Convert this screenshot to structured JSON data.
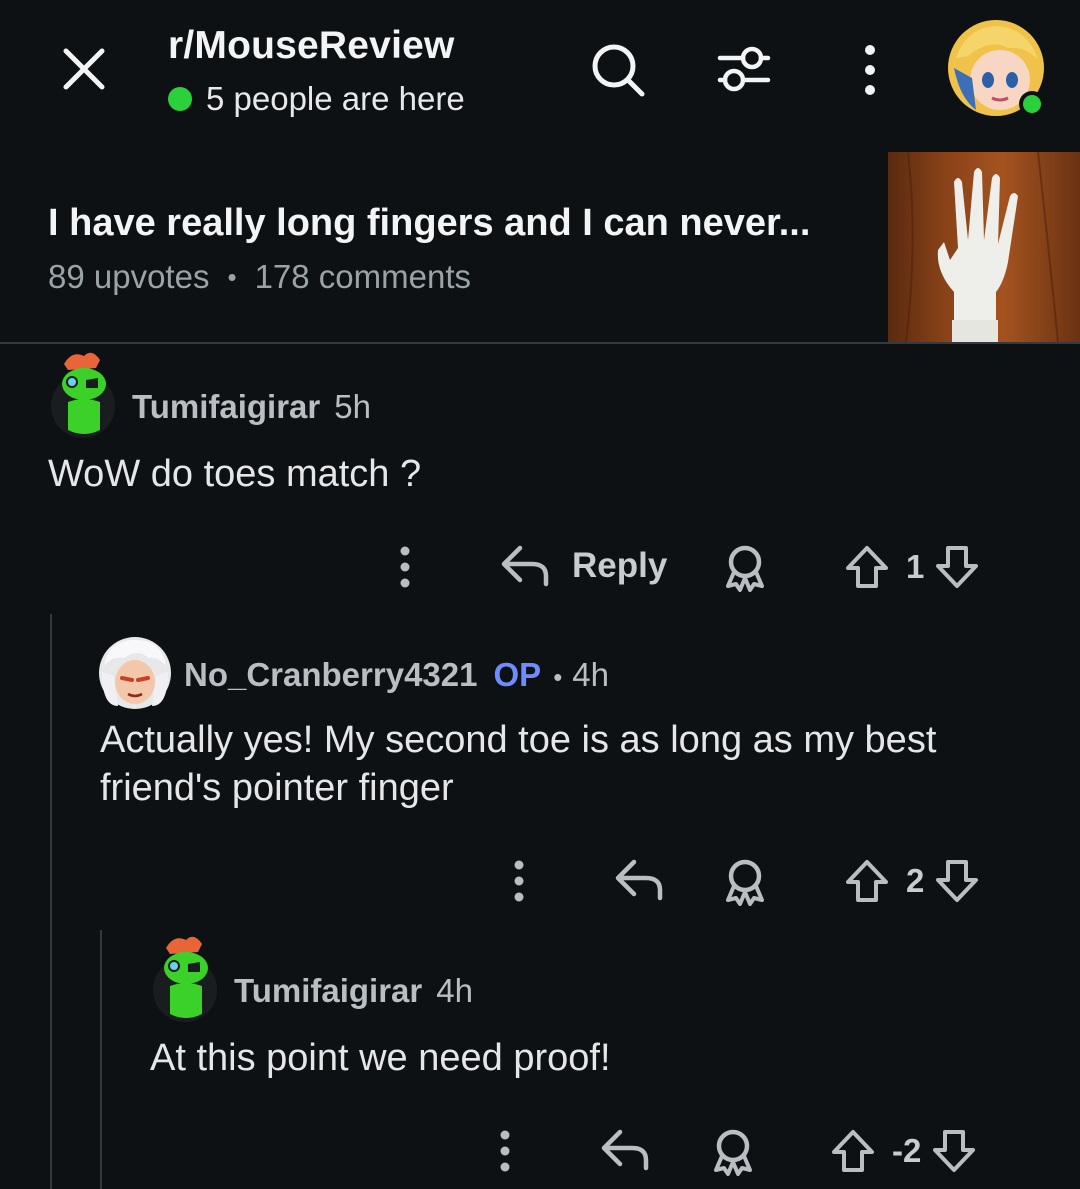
{
  "header": {
    "subreddit": "r/MouseReview",
    "presence": "5 people are here",
    "presence_color": "#2bd13a"
  },
  "post": {
    "title": "I have really long fingers and I can never...",
    "upvotes": "89 upvotes",
    "separator": "•",
    "comments": "178 comments"
  },
  "comments": [
    {
      "username": "Tumifaigirar",
      "time": "5h",
      "body": "WoW do toes match ?",
      "reply_label": "Reply",
      "votes": "1"
    },
    {
      "username": "No_Cranberry4321",
      "op_badge": "OP",
      "separator": "•",
      "time": "4h",
      "body": "Actually yes! My second toe is as long as my best friend's pointer finger",
      "votes": "2"
    },
    {
      "username": "Tumifaigirar",
      "time": "4h",
      "body": "At this point we need proof!",
      "votes": "-2"
    }
  ],
  "colors": {
    "background": "#0e1113",
    "op_badge": "#6f8cff",
    "online": "#2bd13a"
  }
}
